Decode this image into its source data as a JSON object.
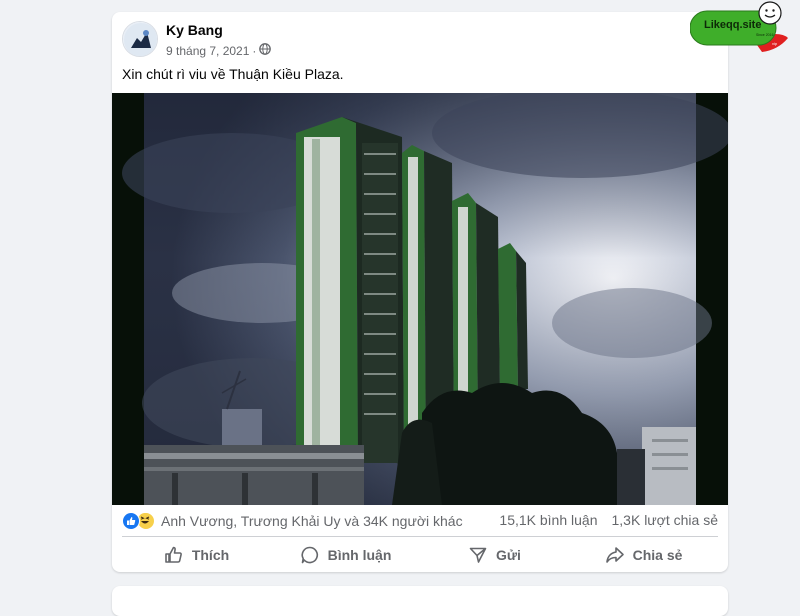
{
  "post": {
    "author": "Ky Bang",
    "date": "9 tháng 7, 2021",
    "separator": "·",
    "privacy_icon": "globe-icon",
    "caption": "Xin chút rì viu về Thuận Kiều Plaza."
  },
  "stats": {
    "reaction_icons": [
      "like-icon",
      "haha-icon"
    ],
    "reactors": "Anh Vương, Trương Khải Uy và 34K người khác",
    "comments": "15,1K bình luận",
    "shares": "1,3K lượt chia sẻ"
  },
  "actions": {
    "like": "Thích",
    "comment": "Bình luận",
    "send": "Gửi",
    "share": "Chia sẻ"
  },
  "watermark": {
    "text": "Likeqq.site",
    "subtext": "Since 2016"
  },
  "colors": {
    "background": "#f0f2f5",
    "card": "#ffffff",
    "text_primary": "#050505",
    "text_secondary": "#65676b",
    "like_blue": "#1877f2",
    "badge_green": "#3fae2a",
    "badge_red": "#e02020"
  }
}
